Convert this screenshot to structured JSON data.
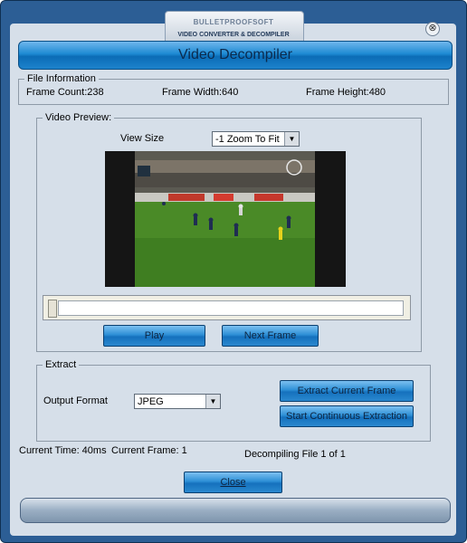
{
  "window": {
    "brand": "BULLETPROOFSOFT",
    "product": "VIDEO CONVERTER & DECOMPILER",
    "title": "Video Decompiler",
    "close_glyph": "⊗"
  },
  "file_info": {
    "legend": "File Information",
    "frame_count": "Frame Count:238",
    "frame_width": "Frame Width:640",
    "frame_height": "Frame Height:480"
  },
  "preview": {
    "legend": "Video Preview:",
    "view_size_label": "View Size",
    "view_size_value": "-1 Zoom To Fit",
    "seek_position": 0.0,
    "play_label": "Play",
    "next_frame_label": "Next Frame"
  },
  "extract": {
    "legend": "Extract",
    "output_format_label": "Output Format",
    "output_format_value": "JPEG",
    "extract_current_label": "Extract Current Frame",
    "start_continuous_label": "Start Continuous Extraction"
  },
  "status": {
    "current_time": "Current Time: 40ms",
    "current_frame": "Current Frame: 1",
    "decompiling": "Decompiling File 1 of 1"
  },
  "footer": {
    "close_label": "Close"
  },
  "icons": {
    "dropdown": "chevron-down-icon",
    "close": "close-icon"
  }
}
